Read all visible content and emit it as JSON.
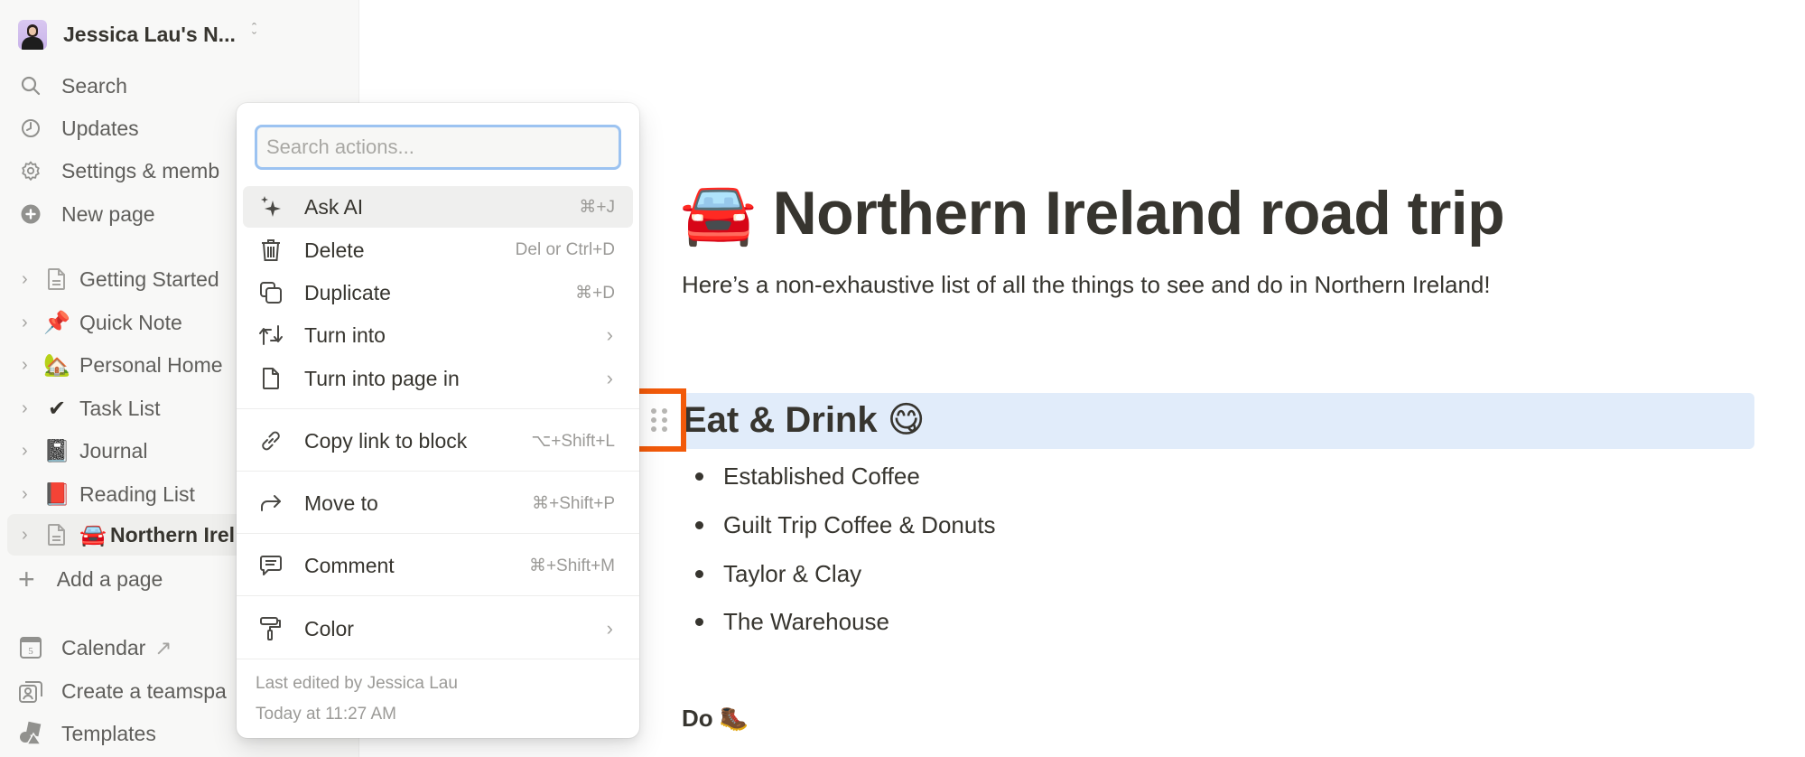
{
  "sidebar": {
    "workspace_name": "Jessica Lau's N...",
    "nav": [
      {
        "label": "Search",
        "icon": "search-icon"
      },
      {
        "label": "Updates",
        "icon": "clock-icon"
      },
      {
        "label": "Settings & memb",
        "icon": "gear-icon"
      },
      {
        "label": "New page",
        "icon": "plus-circle-icon"
      }
    ],
    "pages": [
      {
        "label": "Getting Started",
        "emoji": "",
        "icon": "document-icon"
      },
      {
        "label": "Quick Note",
        "emoji": "📌",
        "icon": "pushpin-icon"
      },
      {
        "label": "Personal Home",
        "emoji": "🏡",
        "icon": "house-icon"
      },
      {
        "label": "Task List",
        "emoji": "✔",
        "icon": "checkmark-icon"
      },
      {
        "label": "Journal",
        "emoji": "📓",
        "icon": "notebook-icon"
      },
      {
        "label": "Reading List",
        "emoji": "📕",
        "icon": "book-icon"
      },
      {
        "label": "Northern Irel",
        "emoji": "🚘",
        "icon": "car-icon",
        "active": true
      }
    ],
    "add_page": "Add a page",
    "bottom": [
      {
        "label": "Calendar",
        "suffix": "↗",
        "icon": "calendar-icon",
        "calendar_day": "5"
      },
      {
        "label": "Create a teamspa",
        "icon": "teamspace-icon"
      },
      {
        "label": "Templates",
        "icon": "shapes-icon"
      }
    ]
  },
  "page": {
    "title_emoji": "🚘",
    "title": "Northern Ireland road trip",
    "subtitle": "Here’s a non-exhaustive list of all the things to see and do in Northern Ireland!",
    "section_heading": "Eat & Drink",
    "section_emoji": "😋",
    "items": [
      "Established Coffee",
      "Guilt Trip Coffee & Donuts",
      "Taylor & Clay",
      "The Warehouse"
    ],
    "next_heading": "Do",
    "next_emoji": "🥾",
    "highlight_color": "#e1ecfa",
    "drag_box_color": "#f25a0a"
  },
  "menu": {
    "search_placeholder": "Search actions...",
    "items": [
      {
        "label": "Ask AI",
        "shortcut": "⌘+J",
        "icon": "sparkles-icon"
      },
      {
        "label": "Delete",
        "shortcut": "Del or Ctrl+D",
        "icon": "trash-icon"
      },
      {
        "label": "Duplicate",
        "shortcut": "⌘+D",
        "icon": "duplicate-icon"
      },
      {
        "label": "Turn into",
        "submenu": "›",
        "icon": "turn-into-icon"
      },
      {
        "label": "Turn into page in",
        "submenu": "›",
        "icon": "page-icon"
      },
      {
        "label": "Copy link to block",
        "shortcut": "⌥+Shift+L",
        "icon": "link-icon"
      },
      {
        "label": "Move to",
        "shortcut": "⌘+Shift+P",
        "icon": "move-arrow-icon"
      },
      {
        "label": "Comment",
        "shortcut": "⌘+Shift+M",
        "icon": "comment-icon"
      },
      {
        "label": "Color",
        "submenu": "›",
        "icon": "paint-roller-icon"
      }
    ],
    "footer_line1": "Last edited by Jessica Lau",
    "footer_line2": "Today at 11:27 AM"
  }
}
